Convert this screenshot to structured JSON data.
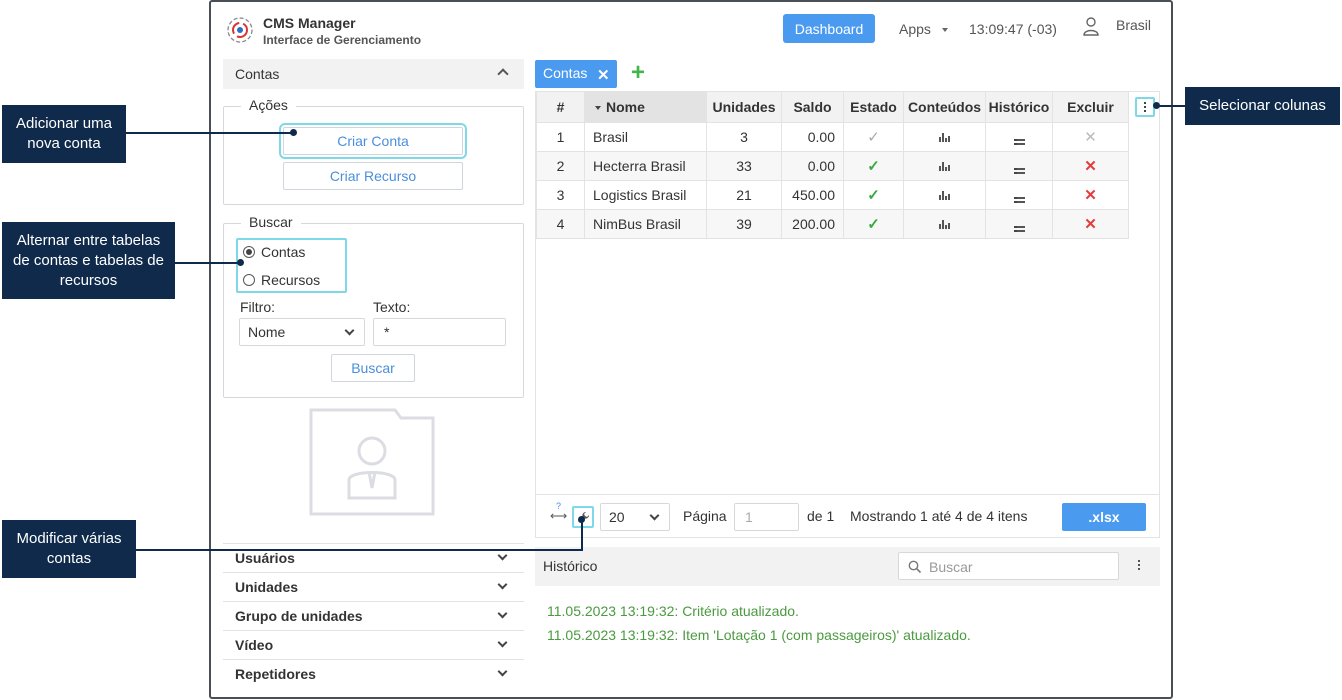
{
  "header": {
    "title": "CMS Manager",
    "subtitle": "Interface de Gerenciamento",
    "dashboard_label": "Dashboard",
    "apps_label": "Apps",
    "time": "13:09:47 (-03)",
    "user": "Brasil"
  },
  "sidebar": {
    "panel_title": "Contas",
    "actions": {
      "legend": "Ações",
      "create_account": "Criar Conta",
      "create_resource": "Criar Recurso"
    },
    "search": {
      "legend": "Buscar",
      "radio_accounts": "Contas",
      "radio_resources": "Recursos",
      "filter_label": "Filtro:",
      "filter_value": "Nome",
      "text_label": "Texto:",
      "text_value": "*",
      "search_button": "Buscar"
    },
    "accordion": [
      "Usuários",
      "Unidades",
      "Grupo de unidades",
      "Vídeo",
      "Repetidores"
    ]
  },
  "tab": {
    "label": "Contas"
  },
  "table": {
    "columns": [
      "#",
      "Nome",
      "Unidades",
      "Saldo",
      "Estado",
      "Conteúdos",
      "Histórico",
      "Excluir"
    ],
    "rows": [
      {
        "n": "1",
        "name": "Brasil",
        "units": "3",
        "balance": "0.00",
        "active": false
      },
      {
        "n": "2",
        "name": "Hecterra Brasil",
        "units": "33",
        "balance": "0.00",
        "active": true
      },
      {
        "n": "3",
        "name": "Logistics Brasil",
        "units": "21",
        "balance": "450.00",
        "active": true
      },
      {
        "n": "4",
        "name": "NimBus Brasil",
        "units": "39",
        "balance": "200.00",
        "active": true
      }
    ]
  },
  "pager": {
    "fit_label": "?",
    "page_size": "20",
    "page_label": "Página",
    "page_value": "1",
    "of_label": "de 1",
    "showing": "Mostrando 1 até 4 de 4 itens",
    "export_label": ".xlsx"
  },
  "history": {
    "title": "Histórico",
    "search_placeholder": "Buscar",
    "lines": [
      "11.05.2023 13:19:32: Critério atualizado.",
      "11.05.2023 13:19:32: Item 'Lotação 1 (com passageiros)' atualizado."
    ]
  },
  "annotations": {
    "add_account": "Adicionar uma nova conta",
    "toggle_tables": "Alternar entre tabelas de contas e tabelas de recursos",
    "modify_accounts": "Modificar várias contas",
    "select_columns": "Selecionar colunas"
  },
  "colors": {
    "accent": "#4a9af0",
    "success": "#3aa83f",
    "danger": "#e33c3c",
    "callout": "#0f2a4a",
    "highlight": "#7fd8e8",
    "history_text": "#4a9a3f"
  }
}
